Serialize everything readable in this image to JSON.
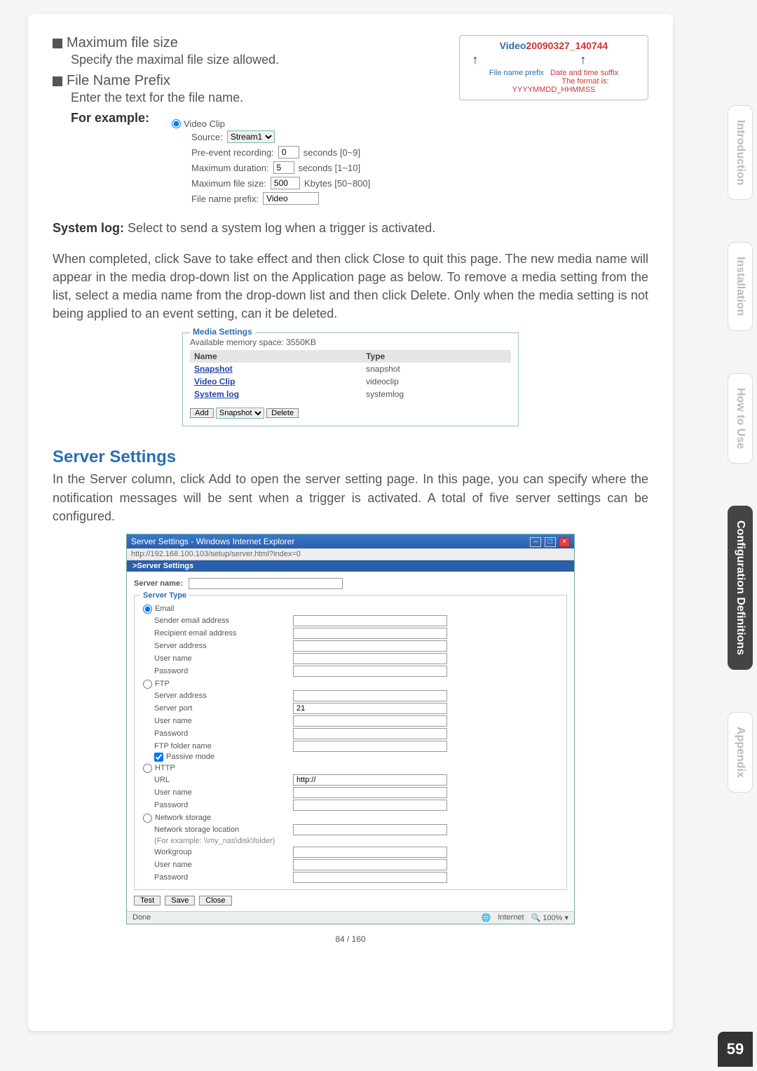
{
  "section1": {
    "title_max": "Maximum file size",
    "sub_max": "Specify the maximal file size allowed.",
    "title_prefix": "File Name Prefix",
    "sub_prefix": "Enter the text for the file name.",
    "for_example": "For example:"
  },
  "prefixbox": {
    "video_word": "Video",
    "timestamp": "20090327_140744",
    "left_label": "File name prefix",
    "right_label_line1": "Date and time suffix",
    "right_label_line2": "The format is: YYYYMMDD_HHMMSS"
  },
  "videoclip": {
    "radio_label": "Video Clip",
    "source_label": "Source:",
    "source_value": "Stream1",
    "pre_event_label": "Pre-event recording:",
    "pre_event_value": "0",
    "pre_event_unit": "seconds [0~9]",
    "max_duration_label": "Maximum duration:",
    "max_duration_value": "5",
    "max_duration_unit": "seconds [1~10]",
    "max_filesize_label": "Maximum file size:",
    "max_filesize_value": "500",
    "max_filesize_unit": "Kbytes [50~800]",
    "fileprefix_label": "File name prefix:",
    "fileprefix_value": "Video"
  },
  "systemlog": {
    "label": "System log:",
    "text": " Select to send a system log when a trigger is activated."
  },
  "para2": "When completed, click Save to take effect and then click Close to quit this page. The new media name will appear in the media drop-down list on the Application page as below. To remove a media setting from the list, select a media name from the drop-down list and then click Delete. Only when the media setting is not being applied to an event setting, can it be deleted.",
  "mediasettings": {
    "legend": "Media Settings",
    "mem": "Available memory space: 3550KB",
    "col_name": "Name",
    "col_type": "Type",
    "rows": [
      {
        "name": "Snapshot",
        "type": "snapshot"
      },
      {
        "name": "Video Clip",
        "type": "videoclip"
      },
      {
        "name": "System log",
        "type": "systemlog"
      }
    ],
    "add_btn": "Add",
    "select_value": "Snapshot",
    "delete_btn": "Delete"
  },
  "server": {
    "heading": "Server Settings",
    "para": "In the Server column, click Add to open the server setting page. In this page, you can specify where the notification messages will be sent when a trigger is activated. A total of five server settings can be configured."
  },
  "iewin": {
    "title": "Server Settings - Windows Internet Explorer",
    "url": "http://192.168.100.103/setup/server.html?index=0",
    "bar": ">Server Settings",
    "server_name_label": "Server name:",
    "server_type_legend": "Server Type",
    "email": {
      "radio": "Email",
      "sender": "Sender email address",
      "recipient": "Recipient email address",
      "server_addr": "Server address",
      "user": "User name",
      "pass": "Password"
    },
    "ftp": {
      "radio": "FTP",
      "server_addr": "Server address",
      "port_label": "Server port",
      "port_value": "21",
      "user": "User name",
      "pass": "Password",
      "folder": "FTP folder name",
      "passive": "Passive mode"
    },
    "http": {
      "radio": "HTTP",
      "url_label": "URL",
      "url_value": "http://",
      "user": "User name",
      "pass": "Password"
    },
    "netstorage": {
      "radio": "Network storage",
      "loc": "Network storage location",
      "example": "(For example: \\\\my_nas\\disk\\folder)",
      "workgroup": "Workgroup",
      "user": "User name",
      "pass": "Password"
    },
    "btn_test": "Test",
    "btn_save": "Save",
    "btn_close": "Close",
    "status_done": "Done",
    "status_internet": "Internet",
    "status_zoom": "100%"
  },
  "pagenum": "84 / 160",
  "tabs": {
    "intro": "Introduction",
    "install": "Installation",
    "howto": "How to Use",
    "config": "Configuration Definitions",
    "appendix": "Appendix"
  },
  "corner": "59"
}
